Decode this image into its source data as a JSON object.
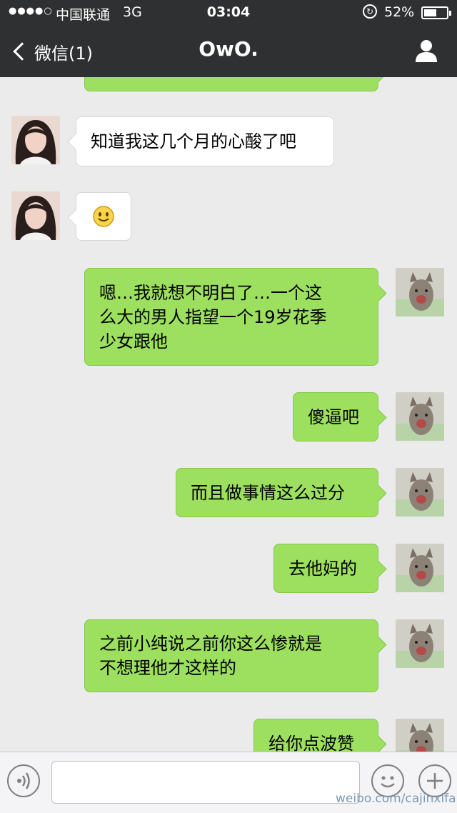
{
  "status_bar": {
    "signal": "●●●●○",
    "carrier": "中国联通",
    "network": "3G",
    "time": "03:04",
    "battery": "52%"
  },
  "nav": {
    "back_label": "微信(1)",
    "title": "OwO."
  },
  "messages": [
    {
      "side": "right",
      "text": ""
    },
    {
      "side": "left",
      "text": "知道我这几个月的心酸了吧"
    },
    {
      "side": "left",
      "text": "",
      "emoji": "smile-emoji"
    },
    {
      "side": "right",
      "text": "嗯…我就想不明白了…一个这\n么大的男人指望一个19岁花季\n少女跟他"
    },
    {
      "side": "right",
      "text": "傻逼吧"
    },
    {
      "side": "right",
      "text": "而且做事情这么过分"
    },
    {
      "side": "right",
      "text": "去他妈的"
    },
    {
      "side": "right",
      "text": "之前小纯说之前你这么惨就是\n不想理他才这样的"
    },
    {
      "side": "right",
      "text": "给你点波赞"
    }
  ],
  "watermark": "weibo.com/cajinxifa",
  "colors": {
    "nav_bg": "#2f3031",
    "chat_bg": "#ebebeb",
    "bubble_green": "#9de060",
    "bubble_white": "#ffffff"
  }
}
